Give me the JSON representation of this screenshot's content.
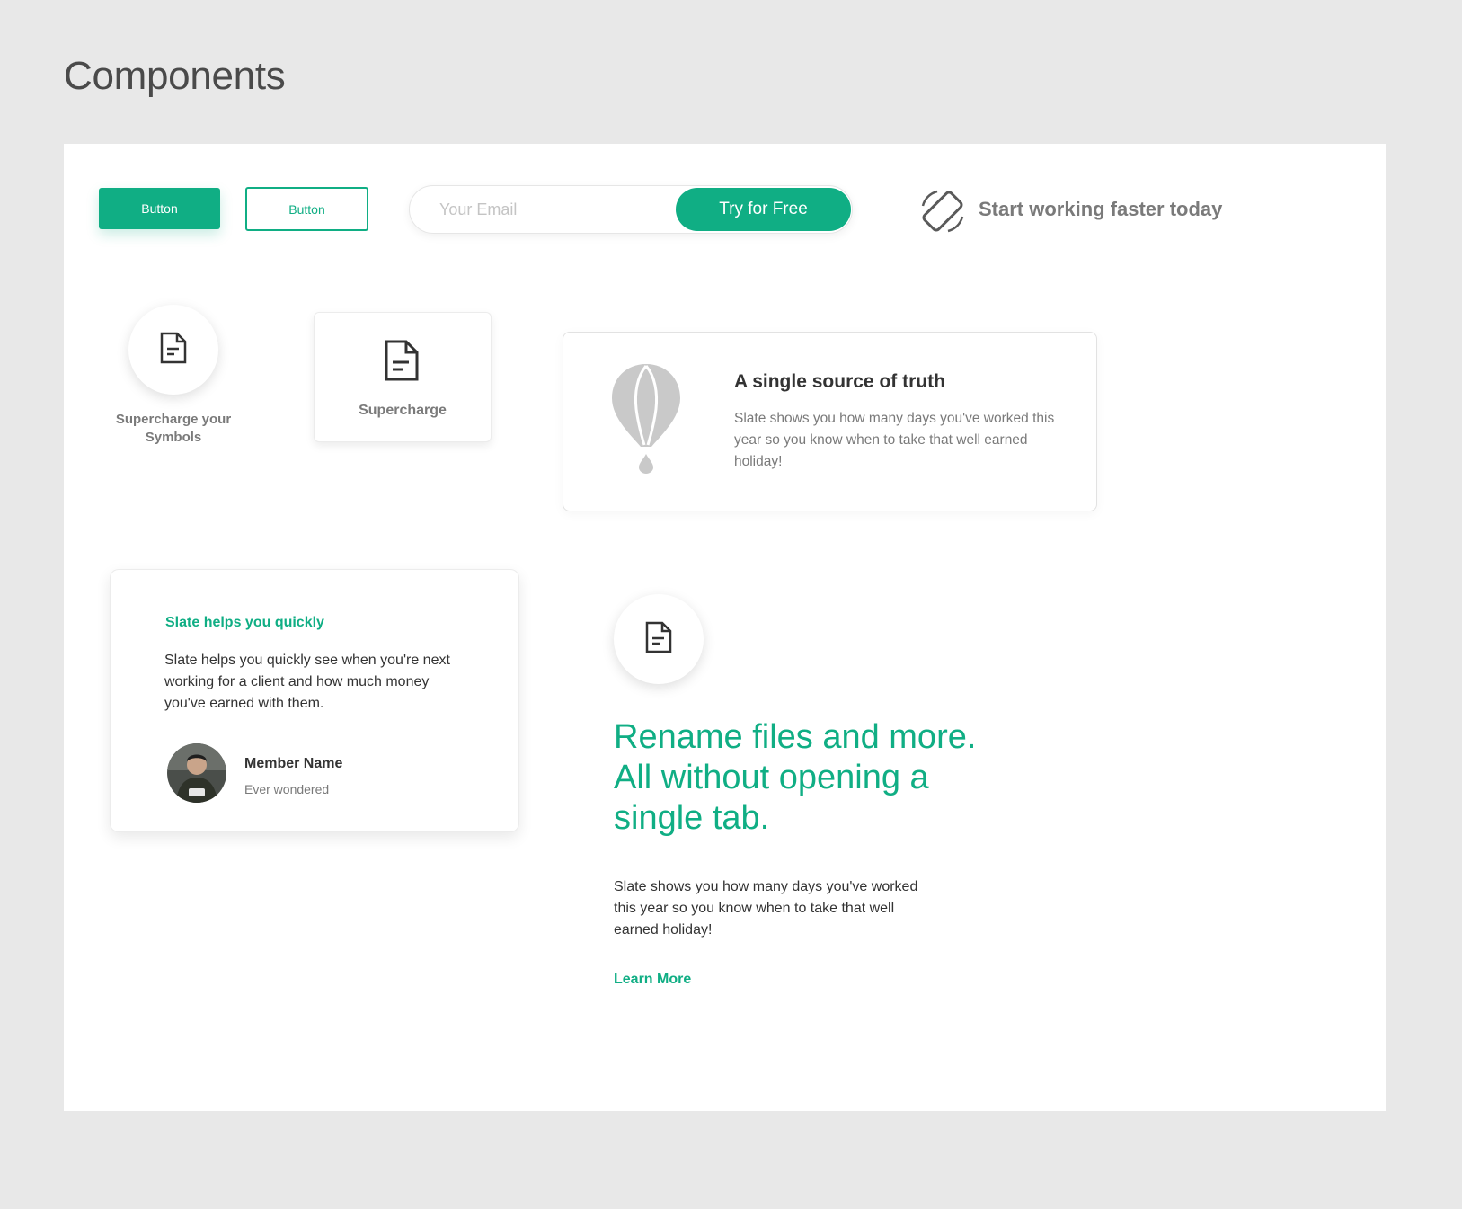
{
  "page": {
    "title": "Components"
  },
  "buttons": {
    "filled_label": "Button",
    "outline_label": "Button"
  },
  "email_form": {
    "placeholder": "Your Email",
    "value": "",
    "submit_label": "Try for Free"
  },
  "tagline": {
    "icon": "screen-rotation-icon",
    "text": "Start working faster today"
  },
  "feature_icon": {
    "icon": "document-icon",
    "label": "Supercharge your Symbols"
  },
  "feature_card": {
    "icon": "document-icon",
    "label": "Supercharge"
  },
  "info_card": {
    "icon": "hot-air-balloon-icon",
    "title": "A single source of truth",
    "body": "Slate shows you how many days you've worked this year so you know when to take that well earned holiday!"
  },
  "testimonial": {
    "heading": "Slate helps you quickly",
    "body": "Slate helps you quickly see when you're next working for a client and how much money you've earned with them.",
    "member_name": "Member Name",
    "member_subtitle": "Ever wondered"
  },
  "hero": {
    "icon": "document-icon",
    "heading": "Rename files and more. All without opening a single tab.",
    "body": "Slate shows you how many days you've worked this year so you know when to take that well earned holiday!",
    "link_label": "Learn More"
  },
  "colors": {
    "accent": "#10ae84",
    "background": "#e8e8e8",
    "panel": "#ffffff",
    "text_dark": "#333333",
    "text_muted": "#7a7a7a"
  }
}
